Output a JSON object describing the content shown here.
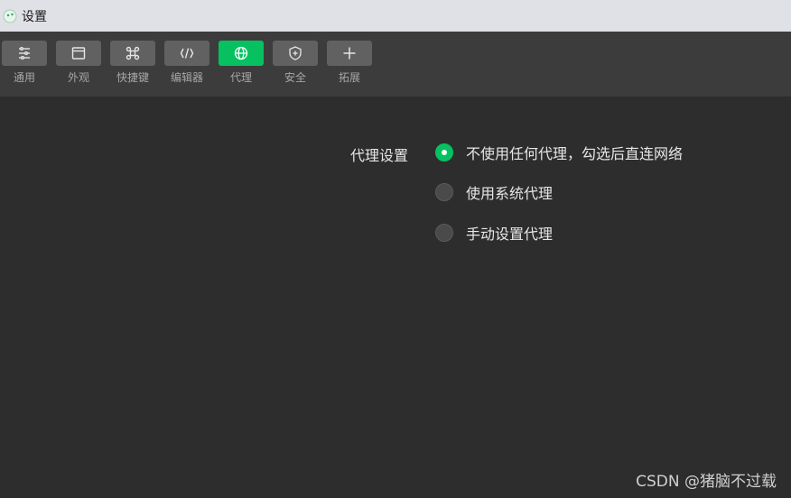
{
  "window": {
    "title": "设置"
  },
  "toolbar": {
    "tabs": [
      {
        "label": "通用",
        "icon": "sliders-icon"
      },
      {
        "label": "外观",
        "icon": "window-icon"
      },
      {
        "label": "快捷键",
        "icon": "command-icon"
      },
      {
        "label": "编辑器",
        "icon": "code-icon"
      },
      {
        "label": "代理",
        "icon": "globe-icon",
        "active": true
      },
      {
        "label": "安全",
        "icon": "shield-plus-icon"
      },
      {
        "label": "拓展",
        "icon": "plus-icon"
      }
    ]
  },
  "proxy": {
    "label": "代理设置",
    "options": [
      {
        "label": "不使用任何代理，勾选后直连网络",
        "checked": true
      },
      {
        "label": "使用系统代理",
        "checked": false
      },
      {
        "label": "手动设置代理",
        "checked": false
      }
    ]
  },
  "watermark": "CSDN @猪脑不过载",
  "colors": {
    "accent": "#07c160",
    "background": "#2d2d2d",
    "toolbar": "#3c3c3c",
    "titlebar": "#dfe1e6"
  }
}
